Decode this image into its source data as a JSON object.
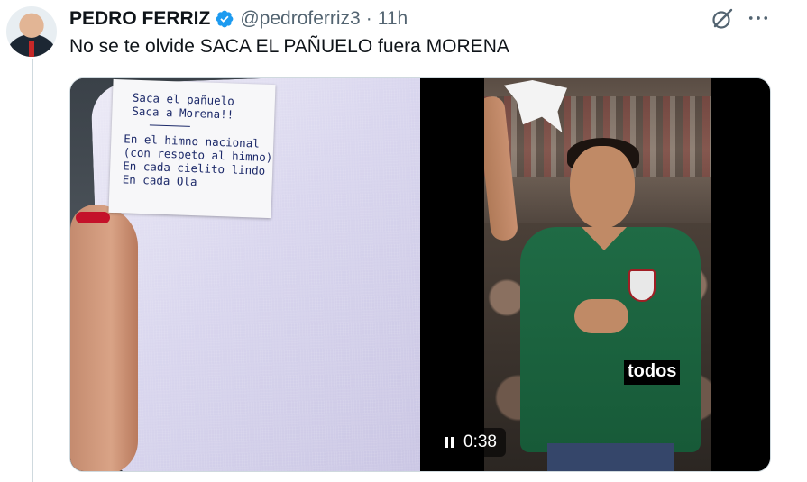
{
  "post": {
    "author_name": "PEDRO FERRIZ",
    "handle": "@pedroferriz3",
    "separator": "·",
    "time": "11h",
    "text": "No se te olvide SACA EL PAÑUELO fuera MORENA"
  },
  "media": {
    "photo_label_lines": [
      "Saca el pañuelo",
      "Saca a Morena!!",
      "En el himno nacional",
      "(con respeto al himno)",
      "En cada cielito lindo",
      "En cada Ola"
    ],
    "video": {
      "caption": "todos",
      "elapsed": "0:38",
      "state": "playing"
    }
  },
  "icons": {
    "verified": "verified-badge-icon",
    "grok": "grok-icon",
    "more": "more-icon",
    "pause": "pause-icon"
  },
  "colors": {
    "text_primary": "#0f1419",
    "text_secondary": "#536471",
    "verified_blue": "#1d9bf0",
    "border": "#cfd9de"
  }
}
